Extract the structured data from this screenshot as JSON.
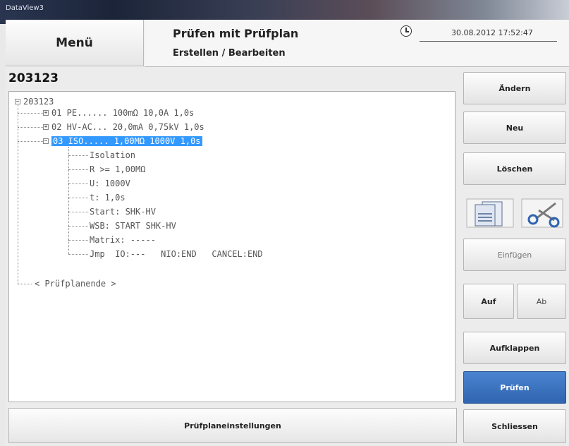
{
  "window": {
    "app_title": "DataView3"
  },
  "header": {
    "menu_label": "Menü",
    "title": "Prüfen mit Prüfplan",
    "subtitle": "Erstellen / Bearbeiten",
    "datetime": "30.08.2012  17:52:47"
  },
  "plan": {
    "id": "203123"
  },
  "tree": {
    "root": "203123",
    "items": [
      {
        "text": "01 PE...... 100mΩ 10,0A 1,0s",
        "expanded": false
      },
      {
        "text": "02 HV-AC... 20,0mA 0,75kV 1,0s",
        "expanded": false
      },
      {
        "text": "03 ISO..... 1,00MΩ 1000V 1,0s",
        "expanded": true,
        "selected": true
      }
    ],
    "details": [
      "Isolation",
      "R >= 1,00MΩ",
      "U: 1000V",
      "t: 1,0s",
      "Start: SHK-HV",
      "WSB: START SHK-HV",
      "Matrix: -----",
      "Jmp  IO:---   NIO:END   CANCEL:END"
    ],
    "end": "< Prüfplanende >"
  },
  "buttons": {
    "aendern": "Ändern",
    "neu": "Neu",
    "loeschen": "Löschen",
    "einfuegen": "Einfügen",
    "auf": "Auf",
    "ab": "Ab",
    "aufklappen": "Aufklappen",
    "pruefen": "Prüfen",
    "schliessen": "Schliessen",
    "settings": "Prüfplaneinstellungen"
  },
  "icons": {
    "copy": "copy-documents-icon",
    "cut": "scissors-icon",
    "clock": "clock-icon"
  },
  "colors": {
    "selection": "#3399ff",
    "primary": "#3a70c0"
  }
}
